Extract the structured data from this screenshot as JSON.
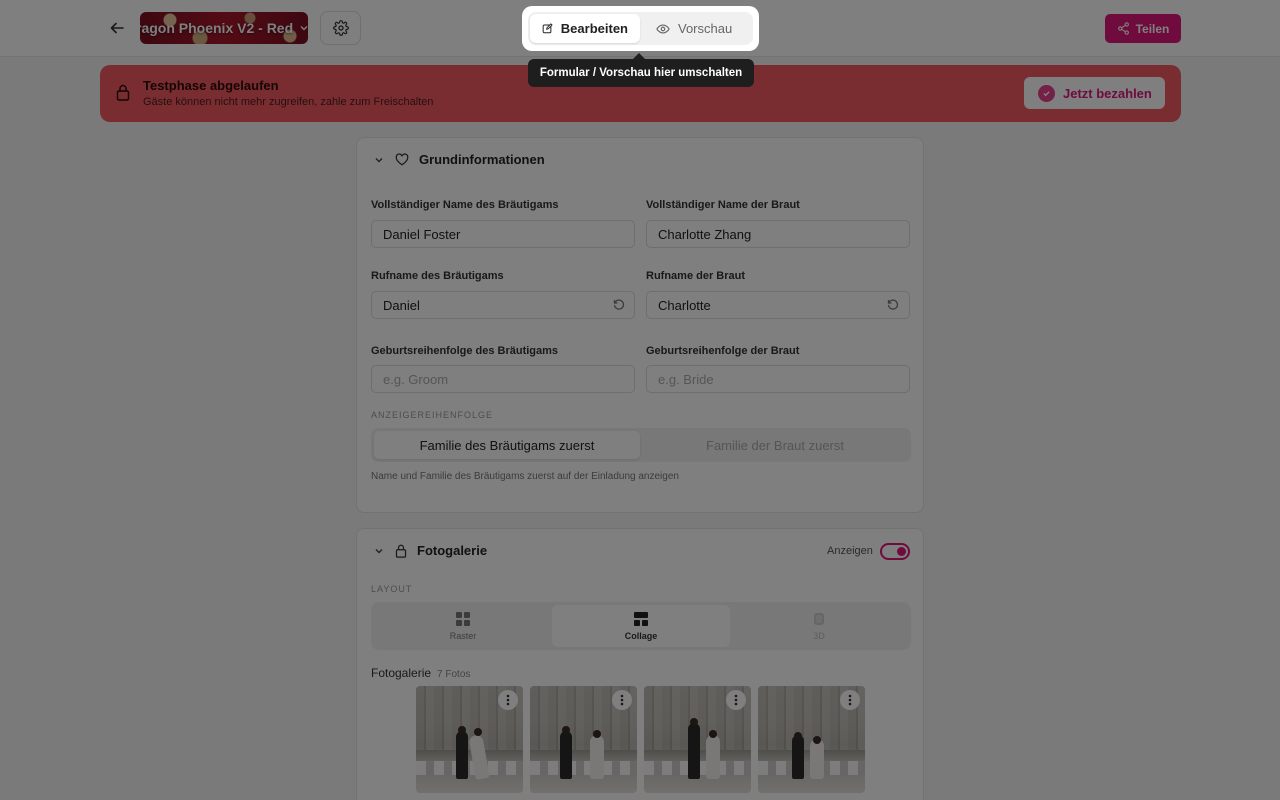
{
  "header": {
    "template_name": "ragon Phoenix V2 - Red",
    "share_label": "Teilen"
  },
  "mode_switch": {
    "edit_label": "Bearbeiten",
    "preview_label": "Vorschau",
    "tooltip": "Formular / Vorschau hier umschalten"
  },
  "banner": {
    "title": "Testphase abgelaufen",
    "subtitle": "Gäste können nicht mehr zugreifen, zahle zum Freischalten",
    "pay_label": "Jetzt bezahlen"
  },
  "basic_info": {
    "section_title": "Grundinformationen",
    "groom_full_name_label": "Vollständiger Name des Bräutigams",
    "groom_full_name_value": "Daniel Foster",
    "bride_full_name_label": "Vollständiger Name der Braut",
    "bride_full_name_value": "Charlotte Zhang",
    "groom_nickname_label": "Rufname des Bräutigams",
    "groom_nickname_value": "Daniel",
    "bride_nickname_label": "Rufname der Braut",
    "bride_nickname_value": "Charlotte",
    "groom_birth_order_label": "Geburtsreihenfolge des Bräutigams",
    "groom_birth_order_placeholder": "e.g. Groom",
    "bride_birth_order_label": "Geburtsreihenfolge der Braut",
    "bride_birth_order_placeholder": "e.g. Bride",
    "display_order_label": "ANZEIGEREIHENFOLGE",
    "display_order_options": [
      "Familie des Bräutigams zuerst",
      "Familie der Braut zuerst"
    ],
    "display_order_hint": "Name und Familie des Bräutigams zuerst auf der Einladung anzeigen"
  },
  "gallery": {
    "section_title": "Fotogalerie",
    "show_label": "Anzeigen",
    "show_enabled": true,
    "layout_label": "LAYOUT",
    "layout_options": [
      "Raster",
      "Collage",
      "3D"
    ],
    "gallery_label": "Fotogalerie",
    "photo_count": "7 Fotos"
  },
  "colors": {
    "accent": "#e0167a",
    "banner": "#f45b62"
  }
}
